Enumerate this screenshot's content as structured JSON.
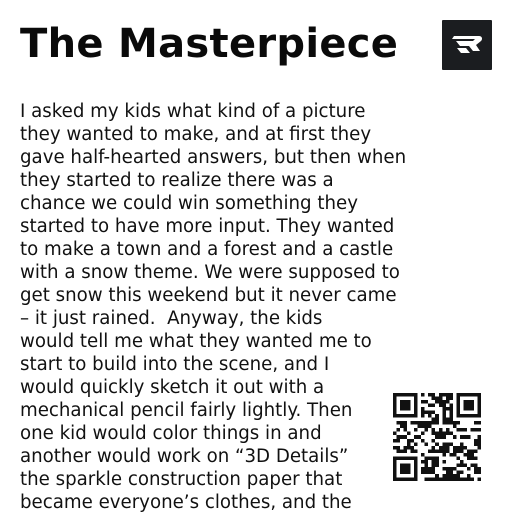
{
  "title": "The Masterpiece",
  "logo": {
    "icon": "brand-logo-icon",
    "background": "#1b1d20",
    "mark": "#ffffff"
  },
  "article": {
    "lines": [
      "I asked my kids what kind of a picture",
      "they wanted to make, and at first they",
      "gave half-hearted answers, but then when",
      "they started to realize there was a",
      "chance we could win something they",
      "started to have more input. They wanted",
      "to make a town and a forest and a castle",
      "with a snow theme. We were supposed to",
      "get snow this weekend but it never came",
      "– it just rained.  Anyway, the kids",
      "would tell me what they wanted me to",
      "start to build into the scene, and I",
      "would quickly sketch it out with a",
      "mechanical pencil fairly lightly. Then",
      "one kid would color things in and",
      "another would work on “3D Details”",
      "the sparkle construction paper that",
      "became everyone’s clothes, and the"
    ]
  },
  "qr_code": {
    "icon": "qr-code-icon"
  }
}
